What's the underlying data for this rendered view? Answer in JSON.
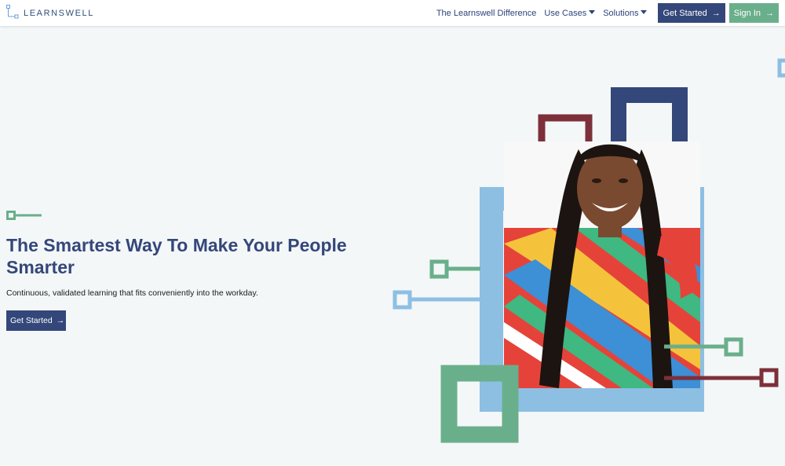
{
  "brand": {
    "name": "LEARNSWELL"
  },
  "nav": {
    "difference": "The Learnswell Difference",
    "use_cases": "Use Cases",
    "solutions": "Solutions",
    "get_started": "Get Started",
    "sign_in": "Sign In"
  },
  "hero": {
    "title": "The Smartest Way To Make Your People Smarter",
    "subtitle": "Continuous, validated learning that fits conveniently into the workday.",
    "cta": "Get Started"
  },
  "icons": {
    "arrow": "→",
    "logo": "learnswell-logo-icon",
    "caret": "caret-down-icon"
  },
  "colors": {
    "navy": "#34477a",
    "green": "#6aaf8b",
    "light_blue": "#8dbfe3",
    "maroon": "#7d3039",
    "background": "#f4f7f8"
  }
}
